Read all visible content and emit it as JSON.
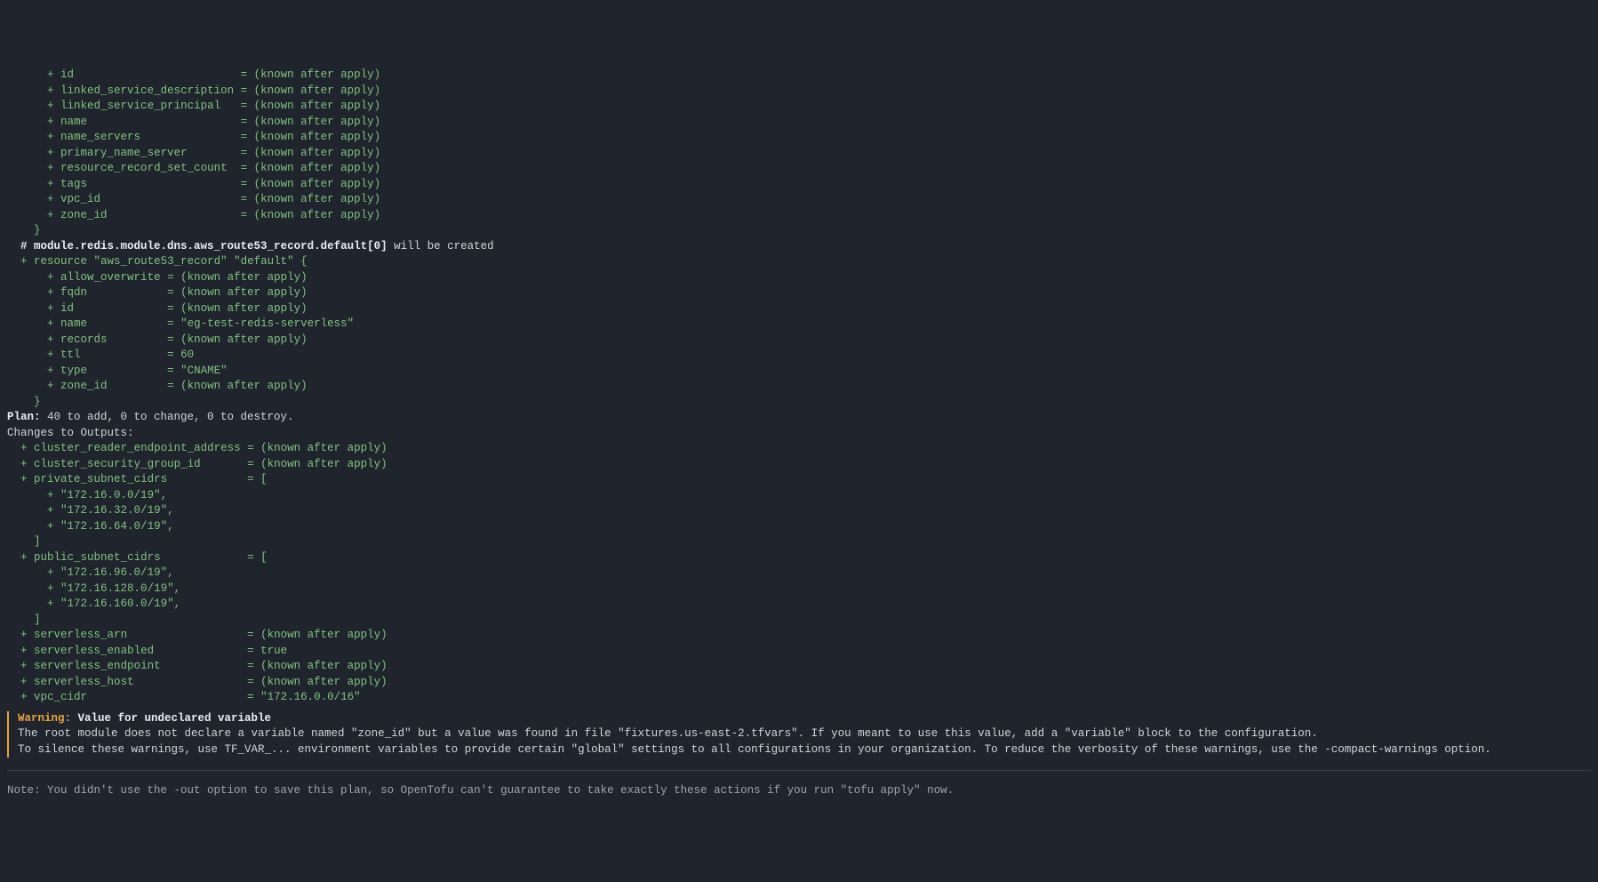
{
  "zone_attrs": [
    [
      "id",
      "(known after apply)"
    ],
    [
      "linked_service_description",
      "(known after apply)"
    ],
    [
      "linked_service_principal",
      "(known after apply)"
    ],
    [
      "name",
      "(known after apply)"
    ],
    [
      "name_servers",
      "(known after apply)"
    ],
    [
      "primary_name_server",
      "(known after apply)"
    ],
    [
      "resource_record_set_count",
      "(known after apply)"
    ],
    [
      "tags",
      "(known after apply)"
    ],
    [
      "vpc_id",
      "(known after apply)"
    ],
    [
      "zone_id",
      "(known after apply)"
    ]
  ],
  "record": {
    "header_hash": "# module.redis.module.dns.aws_route53_record.default[0]",
    "header_suffix": " will be created",
    "decl": "resource \"aws_route53_record\" \"default\" {",
    "attrs": [
      [
        "allow_overwrite",
        "(known after apply)"
      ],
      [
        "fqdn",
        "(known after apply)"
      ],
      [
        "id",
        "(known after apply)"
      ],
      [
        "name",
        "\"eg-test-redis-serverless\""
      ],
      [
        "records",
        "(known after apply)"
      ],
      [
        "ttl",
        "60"
      ],
      [
        "type",
        "\"CNAME\""
      ],
      [
        "zone_id",
        "(known after apply)"
      ]
    ]
  },
  "plan": {
    "label": "Plan:",
    "summary": " 40 to add, 0 to change, 0 to destroy."
  },
  "outputs": {
    "header": "Changes to Outputs:",
    "simple1": [
      [
        "cluster_reader_endpoint_address",
        "(known after apply)"
      ],
      [
        "cluster_security_group_id",
        "(known after apply)"
      ]
    ],
    "private_key": "private_subnet_cidrs",
    "private_vals": [
      "\"172.16.0.0/19\",",
      "\"172.16.32.0/19\",",
      "\"172.16.64.0/19\","
    ],
    "public_key": "public_subnet_cidrs",
    "public_vals": [
      "\"172.16.96.0/19\",",
      "\"172.16.128.0/19\",",
      "\"172.16.160.0/19\","
    ],
    "simple2": [
      [
        "serverless_arn",
        "(known after apply)"
      ],
      [
        "serverless_enabled",
        "true"
      ],
      [
        "serverless_endpoint",
        "(known after apply)"
      ],
      [
        "serverless_host",
        "(known after apply)"
      ],
      [
        "vpc_cidr",
        "\"172.16.0.0/16\""
      ]
    ]
  },
  "warning": {
    "label": "Warning:",
    "title": " Value for undeclared variable",
    "line1": "The root module does not declare a variable named \"zone_id\" but a value was found in file \"fixtures.us-east-2.tfvars\". If you meant to use this value, add a \"variable\" block to the configuration.",
    "line2": "To silence these warnings, use TF_VAR_... environment variables to provide certain \"global\" settings to all configurations in your organization. To reduce the verbosity of these warnings, use the -compact-warnings option."
  },
  "note": "Note: You didn't use the -out option to save this plan, so OpenTofu can't guarantee to take exactly these actions if you run \"tofu apply\" now."
}
